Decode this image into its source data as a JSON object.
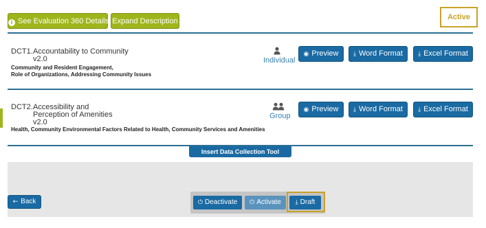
{
  "header": {
    "details_button": "See Evaluation 360 Details",
    "expand_button": "Expand Description",
    "status": "Active"
  },
  "tools": [
    {
      "code": "DCT1.",
      "name": "Accountability to Community v2.0",
      "subtitle_line1": "Community and Resident Engagement,",
      "subtitle_line2": "Role of Organizations, Addressing Community Issues",
      "type": "Individual",
      "type_icon": "person-icon"
    },
    {
      "code": "DCT2.",
      "name": "Accessibility and Perception of Amenities v2.0",
      "subtitle_line1": "Health, Community Environmental Factors Related to Health, Community Services and Amenities",
      "type": "Group",
      "type_icon": "group-icon"
    }
  ],
  "tool_actions": {
    "preview": "Preview",
    "word": "Word Format",
    "excel": "Excel Format"
  },
  "insert_tab": "Insert Data Collection Tool",
  "footer": {
    "back": "Back",
    "deactivate": "Deactivate",
    "activate": "Activate",
    "draft": "Draft"
  },
  "colors": {
    "olive": "#9fb51c",
    "primary": "#1a6aa3",
    "highlight": "#c9a227",
    "rule": "#2a6f95"
  }
}
